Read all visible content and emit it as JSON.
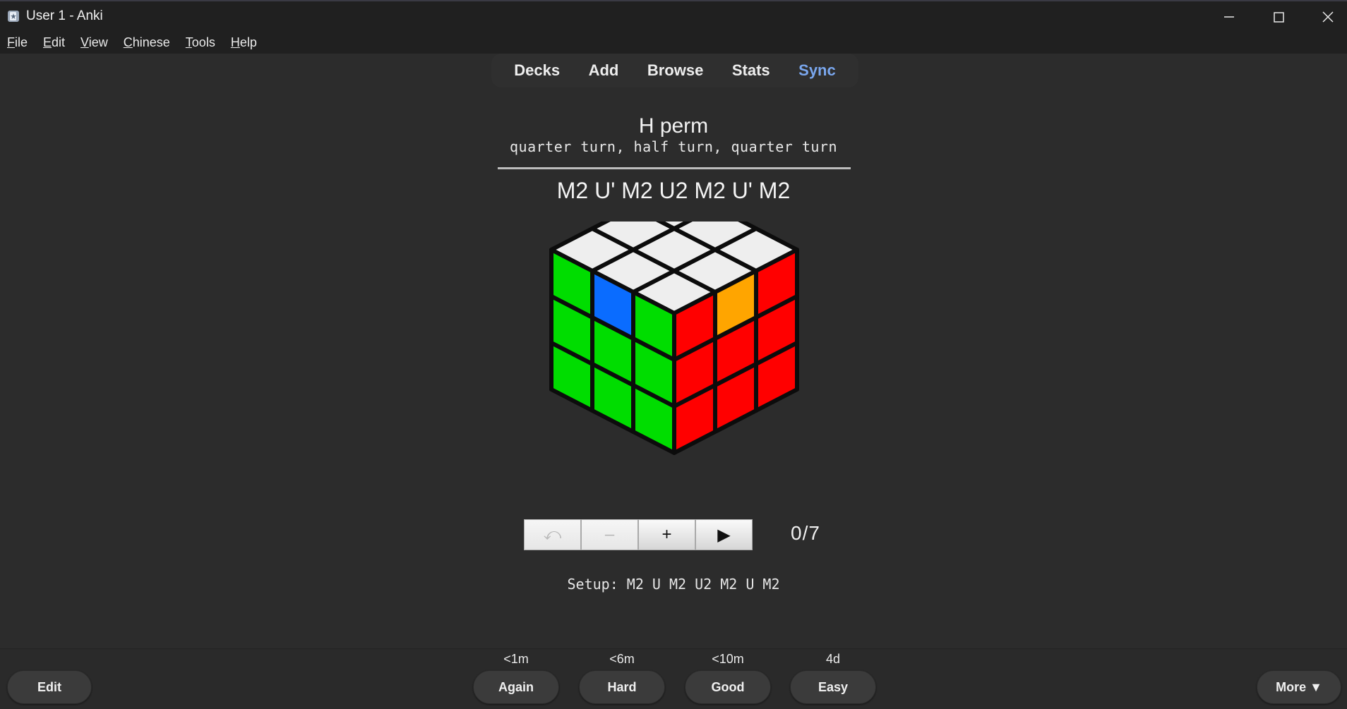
{
  "window": {
    "title": "User 1 - Anki"
  },
  "menu": [
    {
      "label": "File",
      "underline": "F",
      "rest": "ile"
    },
    {
      "label": "Edit",
      "underline": "E",
      "rest": "dit"
    },
    {
      "label": "View",
      "underline": "V",
      "rest": "iew"
    },
    {
      "label": "Chinese",
      "underline": "C",
      "rest": "hinese"
    },
    {
      "label": "Tools",
      "underline": "T",
      "rest": "ools"
    },
    {
      "label": "Help",
      "underline": "H",
      "rest": "elp"
    }
  ],
  "toolbar": {
    "decks": "Decks",
    "add": "Add",
    "browse": "Browse",
    "stats": "Stats",
    "sync": "Sync",
    "sync_color": "#7aa7ee"
  },
  "card": {
    "title": "H perm",
    "subtitle": "quarter turn, half turn, quarter turn",
    "algorithm": "M2 U' M2 U2 M2 U' M2",
    "cube": {
      "top": [
        "white",
        "white",
        "white",
        "white",
        "white",
        "white",
        "white",
        "white",
        "white"
      ],
      "left": [
        "green",
        "blue",
        "green",
        "green",
        "green",
        "green",
        "green",
        "green",
        "green"
      ],
      "right": [
        "red",
        "orange",
        "red",
        "red",
        "red",
        "red",
        "red",
        "red",
        "red"
      ]
    },
    "player": {
      "buttons": [
        "⤺",
        "–",
        "+",
        "▶"
      ],
      "button_names": [
        "reset-button",
        "step-back-button",
        "step-forward-button",
        "play-button"
      ],
      "counter": "0/7"
    },
    "setup": "Setup: M2 U M2 U2 M2 U M2"
  },
  "answer_bar": {
    "edit": "Edit",
    "more": "More ▼",
    "intervals": {
      "again": "<1m",
      "hard": "<6m",
      "good": "<10m",
      "easy": "4d"
    },
    "again": "Again",
    "hard": "Hard",
    "good": "Good",
    "easy": "Easy"
  },
  "colors": {
    "white": "#eeeeee",
    "green": "#00dd00",
    "blue": "#0a6cff",
    "red": "#ff0000",
    "orange": "#ffa500"
  }
}
